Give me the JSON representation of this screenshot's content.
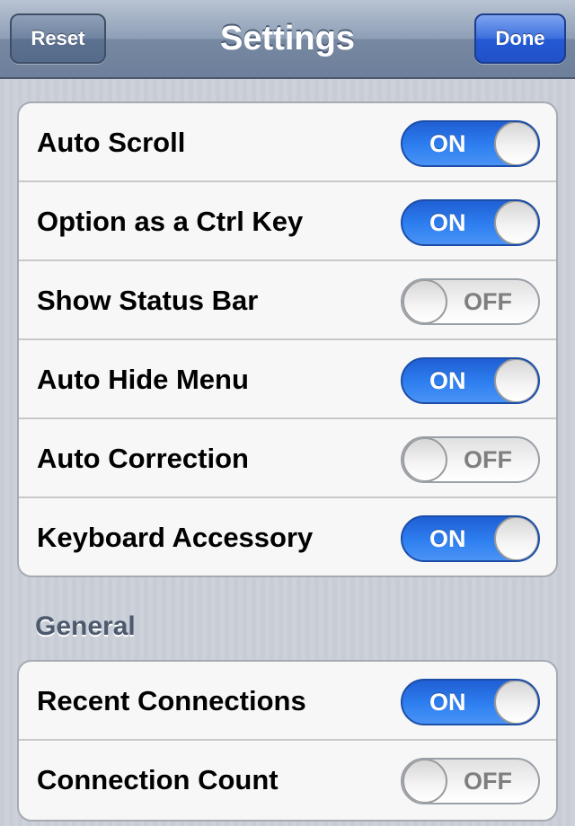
{
  "navbar": {
    "title": "Settings",
    "reset_label": "Reset",
    "done_label": "Done"
  },
  "settings_group": {
    "rows": [
      {
        "label": "Auto Scroll",
        "state": "ON"
      },
      {
        "label": "Option as a Ctrl Key",
        "state": "ON"
      },
      {
        "label": "Show Status Bar",
        "state": "OFF"
      },
      {
        "label": "Auto Hide Menu",
        "state": "ON"
      },
      {
        "label": "Auto Correction",
        "state": "OFF"
      },
      {
        "label": "Keyboard Accessory",
        "state": "ON"
      }
    ]
  },
  "general_group": {
    "header": "General",
    "rows": [
      {
        "label": "Recent Connections",
        "state": "ON"
      },
      {
        "label": "Connection Count",
        "state": "OFF"
      }
    ]
  },
  "colors": {
    "switch_on": "#2e7ff0",
    "done_button": "#245ad4",
    "navbar": "#7788a2",
    "section_header": "#4d5a6e"
  }
}
